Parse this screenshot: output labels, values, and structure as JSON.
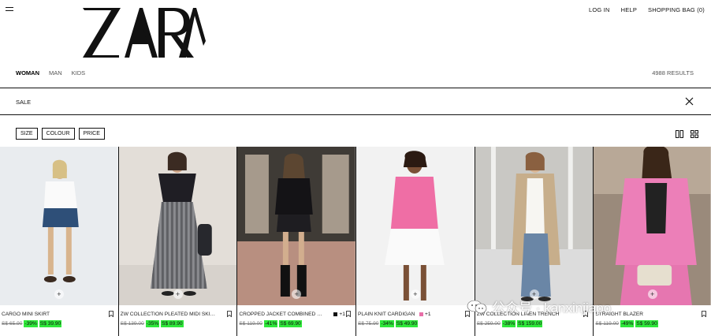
{
  "brand": {
    "logo_text": "ZARA"
  },
  "topnav": {
    "login": "LOG IN",
    "help": "HELP",
    "bag": "SHOPPING BAG (0)"
  },
  "categories": [
    {
      "label": "WOMAN",
      "active": true
    },
    {
      "label": "MAN",
      "active": false
    },
    {
      "label": "KIDS",
      "active": false
    }
  ],
  "results": "4988 RESULTS",
  "search": {
    "term": "SALE"
  },
  "filters": [
    "SIZE",
    "COLOUR",
    "PRICE"
  ],
  "products": [
    {
      "name": "CARGO MINI SKIRT",
      "old_price": "S$ 65.90",
      "discount": "-39%",
      "new_price": "S$ 39.90",
      "swatches": [],
      "more": ""
    },
    {
      "name": "ZW COLLECTION PLEATED MIDI SKIRT",
      "old_price": "S$ 139.00",
      "discount": "-35%",
      "new_price": "S$ 89.90",
      "swatches": [],
      "more": ""
    },
    {
      "name": "CROPPED JACKET COMBINED WI...",
      "old_price": "S$ 119.00",
      "discount": "-41%",
      "new_price": "S$ 69.90",
      "swatches": [
        "#111111"
      ],
      "more": "+1"
    },
    {
      "name": "PLAIN KNIT CARDIGAN",
      "old_price": "S$ 75.90",
      "discount": "-34%",
      "new_price": "S$ 49.90",
      "swatches": [
        "#e86fa8"
      ],
      "more": "+1"
    },
    {
      "name": "ZW COLLECTION LINEN TRENCH",
      "old_price": "S$ 259.00",
      "discount": "-38%",
      "new_price": "S$ 159.00",
      "swatches": [],
      "more": ""
    },
    {
      "name": "STRAIGHT BLAZER",
      "old_price": "S$ 119.00",
      "discount": "-49%",
      "new_price": "S$ 59.90",
      "swatches": [],
      "more": ""
    }
  ],
  "watermark": {
    "text": "公众号 · kanxinjiapo"
  },
  "colors": {
    "discount_highlight": "#2fe83a",
    "text": "#111111"
  }
}
